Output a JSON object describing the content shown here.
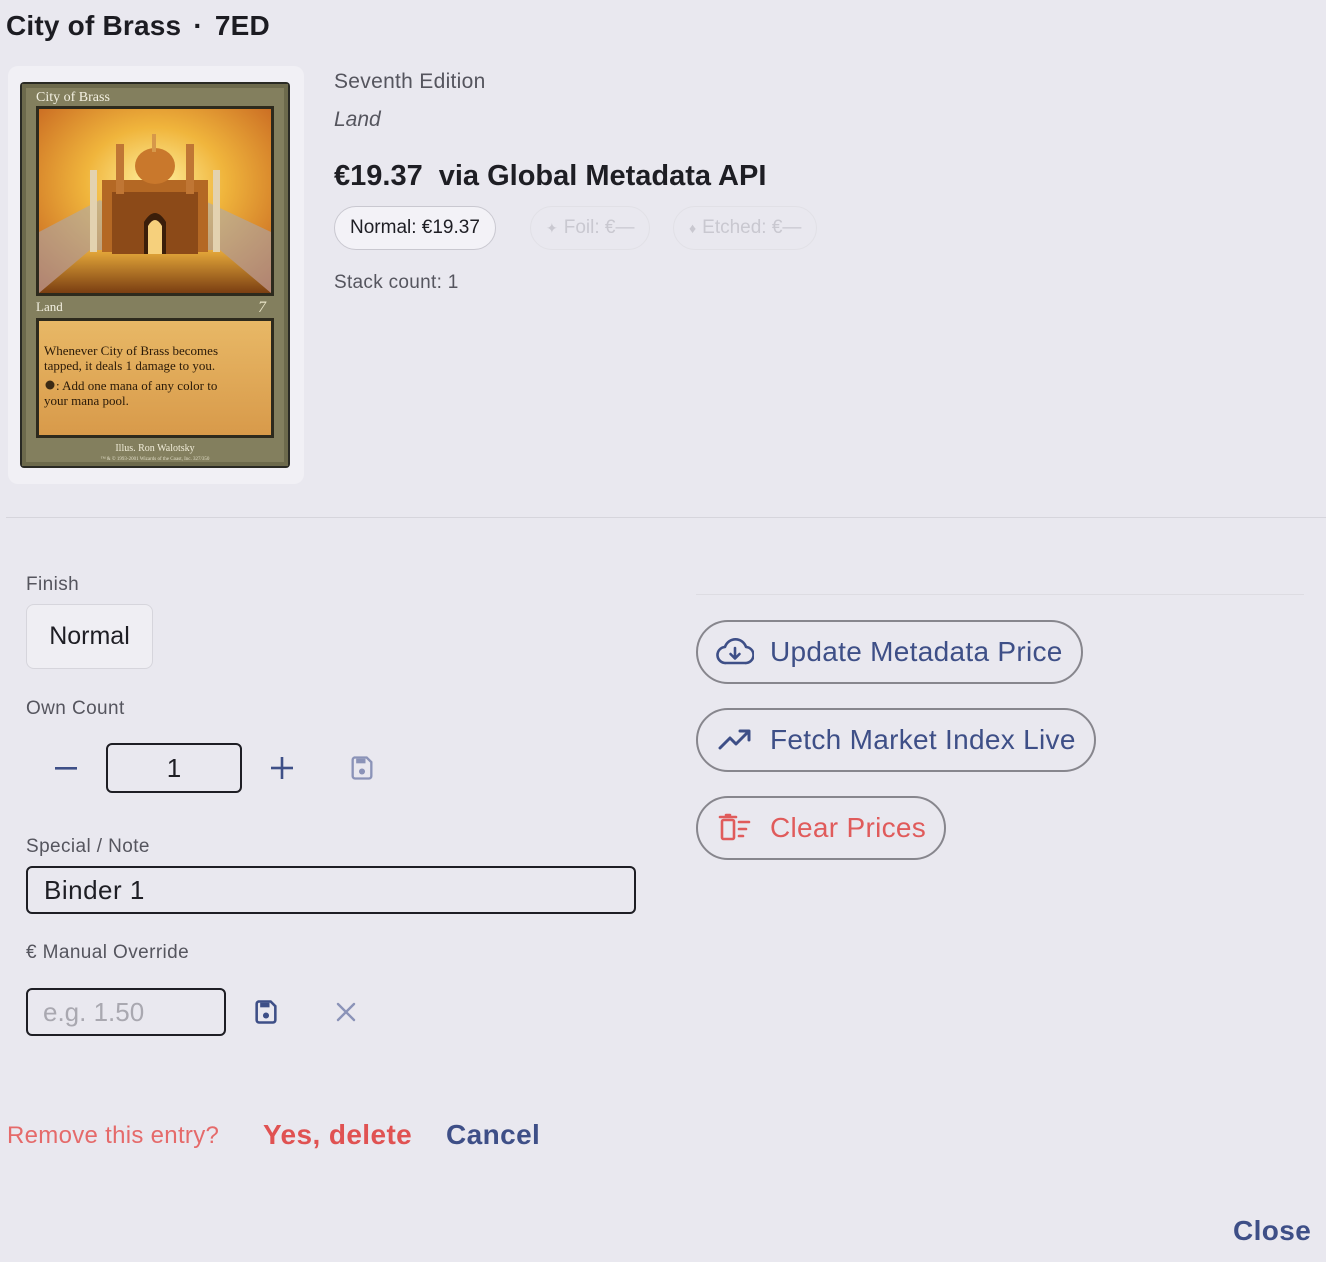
{
  "header": {
    "card_name": "City of Brass",
    "separator": "·",
    "set_code": "7ED"
  },
  "card_image": {
    "name_line": "City of Brass",
    "type_line": "Land",
    "rules_text_1": "Whenever City of Brass becomes",
    "rules_text_2": "tapped, it deals 1 damage to you.",
    "rules_text_3": ": Add one mana of any color to",
    "rules_text_4": "your mana pool.",
    "illustrator": "Illus. Ron Walotsky",
    "copyright": "™ & © 1993-2001 Wizards of the Coast, Inc. 327/350"
  },
  "details": {
    "edition": "Seventh Edition",
    "type": "Land",
    "price": "€19.37",
    "price_source": "via Global Metadata API",
    "stack_count": "Stack count: 1"
  },
  "chips": {
    "normal": "Normal: €19.37",
    "foil": "Foil: €—",
    "etched": "Etched: €—"
  },
  "form": {
    "finish_label": "Finish",
    "finish_value": "Normal",
    "own_count_label": "Own Count",
    "own_count_value": "1",
    "note_label": "Special / Note",
    "note_value": "Binder 1",
    "override_label": "€ Manual Override",
    "override_placeholder": "e.g. 1.50"
  },
  "actions": {
    "update_metadata": "Update Metadata Price",
    "fetch_market": "Fetch Market Index Live",
    "clear_prices": "Clear Prices"
  },
  "delete_confirm": {
    "question": "Remove this entry?",
    "yes": "Yes, delete",
    "cancel": "Cancel"
  },
  "footer": {
    "close": "Close"
  },
  "colors": {
    "background": "#e9e8ef",
    "accent_blue": "#3e4f87",
    "danger_red": "#e05252",
    "muted_text": "#55555e"
  },
  "icons": {
    "update_metadata": "cloud-download-icon",
    "fetch_market": "trending-up-icon",
    "clear_prices": "delete-sweep-icon",
    "decrement": "minus-icon",
    "increment": "plus-icon",
    "save": "save-icon",
    "clear_override": "close-icon"
  }
}
